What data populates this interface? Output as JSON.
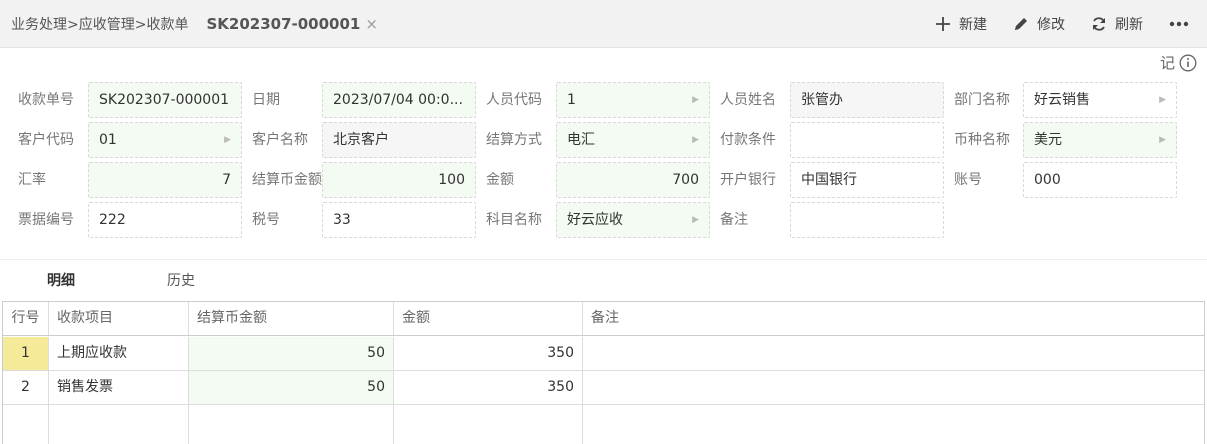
{
  "header": {
    "breadcrumb": "业务处理>应收管理>收款单",
    "doc_tab": "SK202307-000001",
    "close_glyph": "×",
    "toolbar": {
      "new_label": "新建",
      "edit_label": "修改",
      "refresh_label": "刷新"
    },
    "memo_label": "记",
    "icons": [
      "plus-icon",
      "pencil-icon",
      "refresh-icon",
      "more-icon",
      "info-icon"
    ]
  },
  "form": {
    "receipt_no": {
      "label": "收款单号",
      "value": "SK202307-000001"
    },
    "date": {
      "label": "日期",
      "value": "2023/07/04 00:0..."
    },
    "staff_code": {
      "label": "人员代码",
      "value": "1"
    },
    "staff_name": {
      "label": "人员姓名",
      "value": "张管办"
    },
    "dept_name": {
      "label": "部门名称",
      "value": "好云销售"
    },
    "customer_code": {
      "label": "客户代码",
      "value": "01"
    },
    "customer_name": {
      "label": "客户名称",
      "value": "北京客户"
    },
    "settle_method": {
      "label": "结算方式",
      "value": "电汇"
    },
    "pay_terms": {
      "label": "付款条件",
      "value": ""
    },
    "currency": {
      "label": "币种名称",
      "value": "美元"
    },
    "rate": {
      "label": "汇率",
      "value": "7"
    },
    "settle_amount": {
      "label": "结算币金额",
      "value": "100"
    },
    "amount": {
      "label": "金额",
      "value": "700"
    },
    "bank": {
      "label": "开户银行",
      "value": "中国银行"
    },
    "account": {
      "label": "账号",
      "value": "000"
    },
    "bill_no": {
      "label": "票据编号",
      "value": "222"
    },
    "tax_no": {
      "label": "税号",
      "value": "33"
    },
    "subject": {
      "label": "科目名称",
      "value": "好云应收"
    },
    "remark": {
      "label": "备注",
      "value": ""
    }
  },
  "tabs": {
    "detail": "明细",
    "history": "历史"
  },
  "table": {
    "columns": [
      "行号",
      "收款项目",
      "结算币金额",
      "金额",
      "备注"
    ],
    "rows": [
      {
        "no": "1",
        "item": "上期应收款",
        "settle": "50",
        "amount": "350",
        "note": ""
      },
      {
        "no": "2",
        "item": "销售发票",
        "settle": "50",
        "amount": "350",
        "note": ""
      }
    ]
  },
  "colors": {
    "field_green": "#f3fbf2",
    "row_highlight": "#f5ea9a",
    "topbar": "#f2f2f2"
  }
}
